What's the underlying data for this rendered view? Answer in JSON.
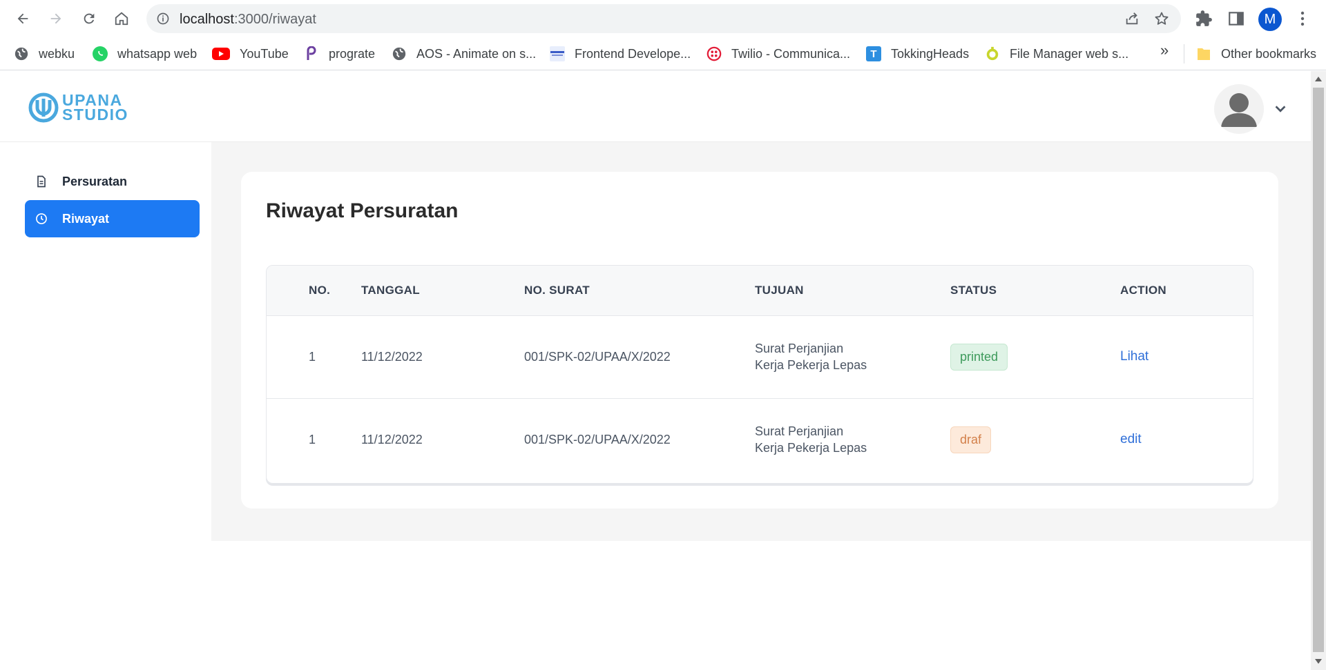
{
  "browser": {
    "url_host": "localhost",
    "url_path": ":3000/riwayat",
    "profile_initial": "M",
    "bookmarks": [
      {
        "label": "webku",
        "icon": "globe-icon"
      },
      {
        "label": "whatsapp web",
        "icon": "whatsapp-icon"
      },
      {
        "label": "YouTube",
        "icon": "youtube-icon"
      },
      {
        "label": "prograte",
        "icon": "prograte-icon"
      },
      {
        "label": "AOS - Animate on s...",
        "icon": "globe-icon"
      },
      {
        "label": "Frontend Develope...",
        "icon": "site-icon"
      },
      {
        "label": "Twilio - Communica...",
        "icon": "twilio-icon"
      },
      {
        "label": "TokkingHeads",
        "icon": "tokkingheads-icon"
      },
      {
        "label": "File Manager web s...",
        "icon": "filemanager-icon"
      }
    ],
    "more_label": "»",
    "other_bookmarks": "Other bookmarks",
    "colors": {
      "profile": "#0b57d0"
    }
  },
  "app": {
    "logo_line1": "UPANA",
    "logo_line2": "STUDIO",
    "sidebar": [
      {
        "label": "Persuratan",
        "icon": "document-icon",
        "active": false
      },
      {
        "label": "Riwayat",
        "icon": "clock-icon",
        "active": true
      }
    ],
    "page_title": "Riwayat Persuratan",
    "table": {
      "headers": [
        "NO.",
        "TANGGAL",
        "NO. SURAT",
        "TUJUAN",
        "STATUS",
        "ACTION"
      ],
      "rows": [
        {
          "no": "1",
          "tanggal": "11/12/2022",
          "no_surat": "001/SPK-02/UPAA/X/2022",
          "tujuan_line1": "Surat Perjanjian",
          "tujuan_line2": "Kerja Pekerja Lepas",
          "status": "printed",
          "action": "Lihat"
        },
        {
          "no": "1",
          "tanggal": "11/12/2022",
          "no_surat": "001/SPK-02/UPAA/X/2022",
          "tujuan_line1": "Surat Perjanjian",
          "tujuan_line2": "Kerja Pekerja Lepas",
          "status": "draf",
          "action": "edit"
        }
      ]
    },
    "colors": {
      "accent": "#1d7af3",
      "logo": "#4aa8de",
      "link": "#2f6fd8",
      "printed": "#3d9a5b",
      "draf": "#d3804a"
    }
  }
}
